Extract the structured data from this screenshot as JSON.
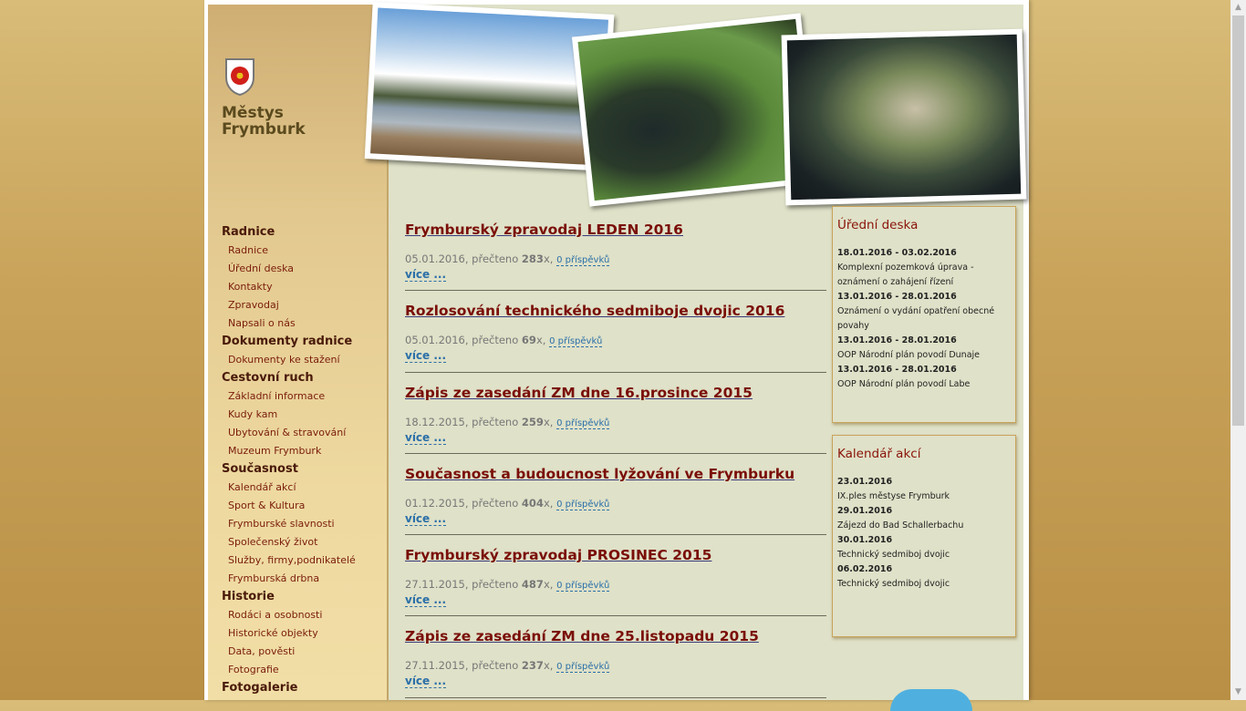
{
  "site": {
    "name_line1": "Městys",
    "name_line2": "Frymburk"
  },
  "nav": [
    {
      "type": "group",
      "label": "Radnice"
    },
    {
      "type": "item",
      "label": "Radnice"
    },
    {
      "type": "item",
      "label": "Úřední deska"
    },
    {
      "type": "item",
      "label": "Kontakty"
    },
    {
      "type": "item",
      "label": "Zpravodaj"
    },
    {
      "type": "item",
      "label": "Napsali o nás"
    },
    {
      "type": "group",
      "label": "Dokumenty radnice"
    },
    {
      "type": "item",
      "label": "Dokumenty ke stažení"
    },
    {
      "type": "group",
      "label": "Cestovní ruch"
    },
    {
      "type": "item",
      "label": "Základní informace"
    },
    {
      "type": "item",
      "label": "Kudy kam"
    },
    {
      "type": "item",
      "label": "Ubytování & stravování"
    },
    {
      "type": "item",
      "label": "Muzeum Frymburk"
    },
    {
      "type": "group",
      "label": "Současnost"
    },
    {
      "type": "item",
      "label": "Kalendář akcí"
    },
    {
      "type": "item",
      "label": "Sport & Kultura"
    },
    {
      "type": "item",
      "label": "Frymburské slavnosti"
    },
    {
      "type": "item",
      "label": "Společenský život"
    },
    {
      "type": "item",
      "label": "Služby, firmy,podnikatelé"
    },
    {
      "type": "item",
      "label": "Frymburská drbna"
    },
    {
      "type": "group",
      "label": "Historie"
    },
    {
      "type": "item",
      "label": "Rodáci a osobnosti"
    },
    {
      "type": "item",
      "label": "Historické objekty"
    },
    {
      "type": "item",
      "label": "Data, pověsti"
    },
    {
      "type": "item",
      "label": "Fotografie"
    },
    {
      "type": "group",
      "label": "Fotogalerie"
    }
  ],
  "articles": [
    {
      "title": "Frymburský zpravodaj LEDEN 2016",
      "date": "05.01.2016",
      "read_label": "přečteno",
      "count": "283",
      "suffix": "x,",
      "posts": "0 příspěvků",
      "more": "více ..."
    },
    {
      "title": "Rozlosování technického sedmiboje dvojic 2016",
      "date": "05.01.2016",
      "read_label": "přečteno",
      "count": "69",
      "suffix": "x,",
      "posts": "0 příspěvků",
      "more": "více ..."
    },
    {
      "title": "Zápis ze zasedání ZM dne 16.prosince 2015",
      "date": "18.12.2015",
      "read_label": "přečteno",
      "count": "259",
      "suffix": "x,",
      "posts": "0 příspěvků",
      "more": "více ..."
    },
    {
      "title": "Současnost a budoucnost lyžování ve Frymburku",
      "date": "01.12.2015",
      "read_label": "přečteno",
      "count": "404",
      "suffix": "x,",
      "posts": "0 příspěvků",
      "more": "více ..."
    },
    {
      "title": "Frymburský zpravodaj PROSINEC 2015",
      "date": "27.11.2015",
      "read_label": "přečteno",
      "count": "487",
      "suffix": "x,",
      "posts": "0 příspěvků",
      "more": "více ..."
    },
    {
      "title": "Zápis ze zasedání ZM dne 25.listopadu 2015",
      "date": "27.11.2015",
      "read_label": "přečteno",
      "count": "237",
      "suffix": "x,",
      "posts": "0 příspěvků",
      "more": "více ..."
    }
  ],
  "official_board": {
    "title": "Úřední deska",
    "entries": [
      {
        "date": "18.01.2016 - 03.02.2016",
        "text": "Komplexní pozemková úprava - oznámení o zahájení řízení"
      },
      {
        "date": "13.01.2016 - 28.01.2016",
        "text": "Oznámení o vydání opatření obecné povahy"
      },
      {
        "date": "13.01.2016 - 28.01.2016",
        "text": "OOP Národní plán povodí Dunaje"
      },
      {
        "date": "13.01.2016 - 28.01.2016",
        "text": "OOP Národní plán povodí Labe"
      }
    ]
  },
  "events": {
    "title": "Kalendář akcí",
    "entries": [
      {
        "date": "23.01.2016",
        "text": "IX.ples městyse Frymburk"
      },
      {
        "date": "29.01.2016",
        "text": "Zájezd do Bad Schallerbachu"
      },
      {
        "date": "30.01.2016",
        "text": "Technický sedmiboj dvojic"
      },
      {
        "date": "06.02.2016",
        "text": "Technický sedmiboj dvojic"
      }
    ]
  },
  "colors": {
    "accent": "#7a0e08",
    "link": "#2a6fa8",
    "content_bg": "#dfe1c8",
    "sidebar": "#eed9a0"
  },
  "icons": {
    "crest": "crest-icon",
    "scroll_up": "scroll-up-icon",
    "scroll_down": "scroll-down-icon"
  }
}
